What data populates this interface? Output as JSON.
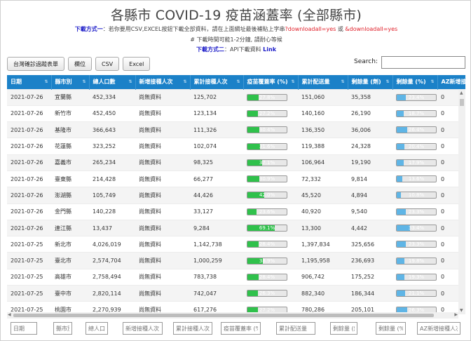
{
  "title": "各縣市 COVID-19 疫苗涵蓋率 (全部縣市)",
  "download1": {
    "label": "下載方式一",
    "text": "：若你要用CSV,EXCEL按鈕下載全部資料，請在上面網址最後補貼上字串",
    "param1": "?downloadall=yes",
    "or": " 或 ",
    "param2": "&downloadall=yes"
  },
  "note": "# 下載時間可能1-2分鐘, 請耐心等候",
  "download2": {
    "label": "下載方式二",
    "text": "：API下載資料 ",
    "link": "Link"
  },
  "buttons": [
    "台灣確診過蹤表單",
    "欄位",
    "CSV",
    "Excel"
  ],
  "search": {
    "label": "Search:",
    "value": ""
  },
  "columns": [
    "日期",
    "縣市別",
    "總人口數",
    "新增接種人次",
    "累計接種人次",
    "疫苗覆蓋率 (%)",
    "累計配送量",
    "剩餘量 (劑)",
    "剩餘量 (%)",
    "AZ新增接種人次"
  ],
  "rows": [
    [
      "2021-07-26",
      "宜蘭縣",
      "452,334",
      "尚無資料",
      "125,702",
      27.8,
      "151,060",
      "35,358",
      23.4,
      "0"
    ],
    [
      "2021-07-26",
      "新竹市",
      "452,450",
      "尚無資料",
      "123,134",
      27.2,
      "140,160",
      "26,190",
      18.7,
      "0"
    ],
    [
      "2021-07-26",
      "基隆市",
      "366,643",
      "尚無資料",
      "111,326",
      30.4,
      "136,350",
      "36,006",
      26.4,
      "0"
    ],
    [
      "2021-07-26",
      "花蓮縣",
      "323,252",
      "尚無資料",
      "102,074",
      31.6,
      "119,388",
      "24,328",
      20.4,
      "0"
    ],
    [
      "2021-07-26",
      "嘉義市",
      "265,234",
      "尚無資料",
      "98,325",
      37.1,
      "106,964",
      "19,190",
      17.9,
      "0"
    ],
    [
      "2021-07-26",
      "臺東縣",
      "214,428",
      "尚無資料",
      "66,277",
      30.9,
      "72,332",
      "9,814",
      13.6,
      "0"
    ],
    [
      "2021-07-26",
      "澎湖縣",
      "105,749",
      "尚無資料",
      "44,426",
      42.0,
      "45,520",
      "4,894",
      10.8,
      "0"
    ],
    [
      "2021-07-26",
      "金門縣",
      "140,228",
      "尚無資料",
      "33,127",
      23.6,
      "40,920",
      "9,540",
      23.3,
      "0"
    ],
    [
      "2021-07-26",
      "連江縣",
      "13,437",
      "尚無資料",
      "9,284",
      69.1,
      "13,300",
      "4,442",
      33.4,
      "0"
    ],
    [
      "2021-07-25",
      "新北市",
      "4,026,019",
      "尚無資料",
      "1,142,738",
      28.4,
      "1,397,834",
      "325,656",
      23.3,
      "0"
    ],
    [
      "2021-07-25",
      "臺北市",
      "2,574,704",
      "尚無資料",
      "1,000,259",
      38.9,
      "1,195,958",
      "236,693",
      19.8,
      "0"
    ],
    [
      "2021-07-25",
      "高雄市",
      "2,758,494",
      "尚無資料",
      "783,738",
      28.4,
      "906,742",
      "175,252",
      19.3,
      "0"
    ],
    [
      "2021-07-25",
      "臺中市",
      "2,820,114",
      "尚無資料",
      "742,047",
      26.3,
      "882,340",
      "186,344",
      21.1,
      "0"
    ],
    [
      "2021-07-25",
      "桃園市",
      "2,270,939",
      "尚無資料",
      "617,276",
      27.2,
      "780,286",
      "205,101",
      26.3,
      "0"
    ]
  ],
  "filters": [
    "日期",
    "縣市別",
    "總人口數",
    "新增接種人次",
    "累計接種人次",
    "疫苗覆蓋率 (%)",
    "累計配送量",
    "剩餘量 (劑)",
    "剩餘量 (%)",
    "AZ新增接種人次"
  ],
  "colors": {
    "header": "#1b81c8",
    "green_bar": "#2fc14b",
    "blue_bar": "#5fb5e6",
    "link": "#1a1ac8",
    "param": "#e0202a"
  }
}
